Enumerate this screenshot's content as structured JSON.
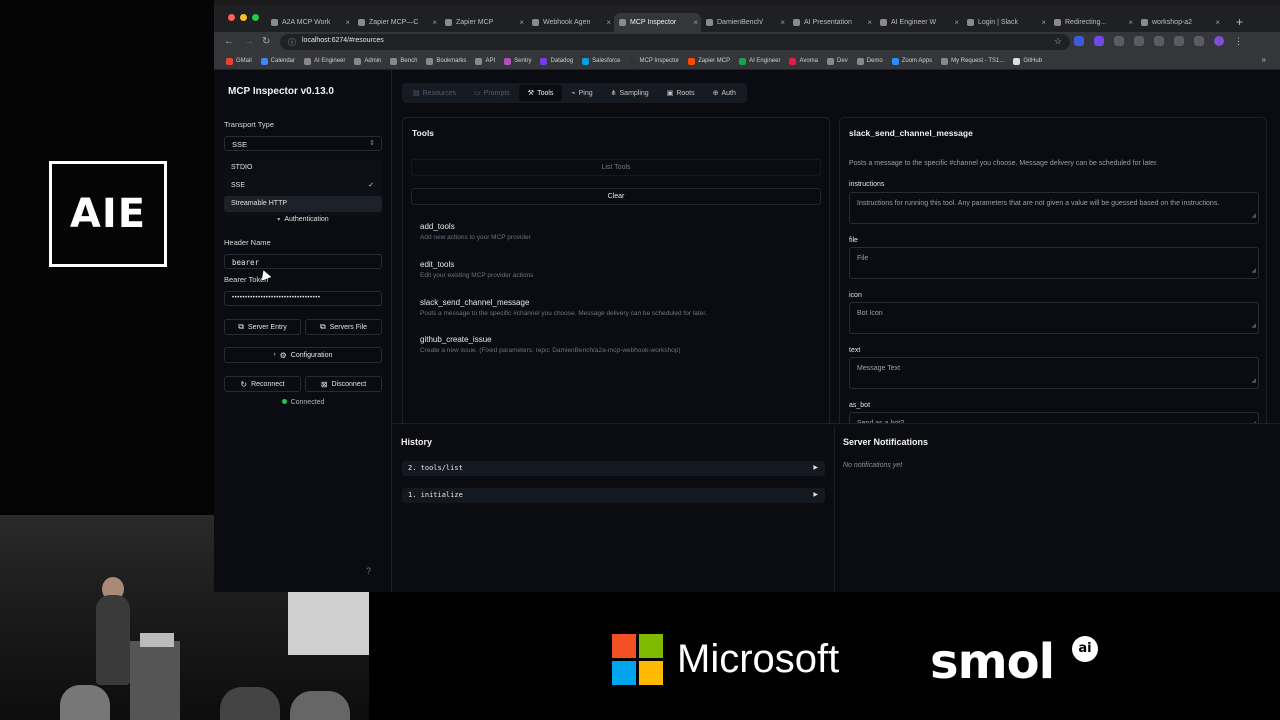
{
  "brand": {
    "left_logo": "AIE",
    "sponsor_microsoft": "Microsoft",
    "sponsor_smol": "smol",
    "smol_badge": "ai"
  },
  "browser": {
    "tabs": [
      {
        "label": "A2A MCP Work",
        "active": false
      },
      {
        "label": "Zapier MCP—C",
        "active": false
      },
      {
        "label": "Zapier MCP",
        "active": false
      },
      {
        "label": "Webhook Agen",
        "active": false
      },
      {
        "label": "MCP Inspector",
        "active": true
      },
      {
        "label": "DamienBench/",
        "active": false
      },
      {
        "label": "AI Presentation",
        "active": false
      },
      {
        "label": "AI Engineer W",
        "active": false
      },
      {
        "label": "Login | Slack",
        "active": false
      },
      {
        "label": "Redirecting...",
        "active": false
      },
      {
        "label": "workshop-a2",
        "active": false
      }
    ],
    "url": "localhost:6274/#resources",
    "bookmarks": [
      {
        "label": "GMail",
        "color": "#ea4335"
      },
      {
        "label": "Calendar",
        "color": "#4285f4"
      },
      {
        "label": "AI Engineer",
        "color": "#888888"
      },
      {
        "label": "Admin",
        "color": "#888888"
      },
      {
        "label": "Bench",
        "color": "#888888"
      },
      {
        "label": "Bookmarks",
        "color": "#888888"
      },
      {
        "label": "API",
        "color": "#888888"
      },
      {
        "label": "Sentry",
        "color": "#b04fbf"
      },
      {
        "label": "Datadog",
        "color": "#7c3aed"
      },
      {
        "label": "Salesforce",
        "color": "#00a1e0"
      },
      {
        "label": "MCP Inspector",
        "color": "#333333"
      },
      {
        "label": "Zapier MCP",
        "color": "#ff4a00"
      },
      {
        "label": "AI Engineer",
        "color": "#16a34a"
      },
      {
        "label": "Avoma",
        "color": "#e11d48"
      },
      {
        "label": "Dev",
        "color": "#888888"
      },
      {
        "label": "Demo",
        "color": "#888888"
      },
      {
        "label": "Zoom Apps",
        "color": "#2d8cff"
      },
      {
        "label": "My Request - TS1...",
        "color": "#888888"
      },
      {
        "label": "GitHub",
        "color": "#dddddd"
      }
    ]
  },
  "sidebar": {
    "title": "MCP Inspector v0.13.0",
    "transport_label": "Transport Type",
    "transport_value": "SSE",
    "transport_options": [
      {
        "label": "STDIO",
        "selected": false
      },
      {
        "label": "SSE",
        "selected": true
      },
      {
        "label": "Streamable HTTP",
        "selected": false
      }
    ],
    "authentication": "Authentication",
    "header_name_label": "Header Name",
    "header_name_value": "bearer",
    "bearer_label": "Bearer Token",
    "bearer_value": "••••••••••••••••••••••••••••••••••",
    "server_entry": "Server Entry",
    "servers_file": "Servers File",
    "configuration": "Configuration",
    "reconnect": "Reconnect",
    "disconnect": "Disconnect",
    "status": "Connected"
  },
  "main": {
    "tabs": [
      {
        "label": "Resources",
        "state": "dim"
      },
      {
        "label": "Prompts",
        "state": "dim"
      },
      {
        "label": "Tools",
        "state": "active"
      },
      {
        "label": "Ping",
        "state": "normal"
      },
      {
        "label": "Sampling",
        "state": "normal"
      },
      {
        "label": "Roots",
        "state": "normal"
      },
      {
        "label": "Auth",
        "state": "normal"
      }
    ],
    "tools_title": "Tools",
    "list_tools": "List Tools",
    "clear": "Clear",
    "tools": [
      {
        "name": "add_tools",
        "desc": "Add new actions to your MCP provider"
      },
      {
        "name": "edit_tools",
        "desc": "Edit your existing MCP provider actions"
      },
      {
        "name": "slack_send_channel_message",
        "desc": "Posts a message to the specific #channel you choose. Message delivery can be scheduled for later."
      },
      {
        "name": "github_create_issue",
        "desc": "Create a new issue. (Fixed parameters: repo: DamienBench/a2a-mcp-webhook-workshop)"
      }
    ]
  },
  "detail": {
    "title": "slack_send_channel_message",
    "description": "Posts a message to the specific #channel you choose. Message delivery can be scheduled for later.",
    "fields": [
      {
        "label": "instructions",
        "placeholder": "Instructions for running this tool. Any parameters that are not given a value will be guessed based on the instructions."
      },
      {
        "label": "file",
        "placeholder": "File"
      },
      {
        "label": "icon",
        "placeholder": "Bot Icon"
      },
      {
        "label": "text",
        "placeholder": "Message Text"
      },
      {
        "label": "as_bot",
        "placeholder": "Send as a bot?"
      }
    ]
  },
  "history": {
    "title": "History",
    "items": [
      "2. tools/list",
      "1. initialize"
    ]
  },
  "notifications": {
    "title": "Server Notifications",
    "empty": "No notifications yet"
  }
}
